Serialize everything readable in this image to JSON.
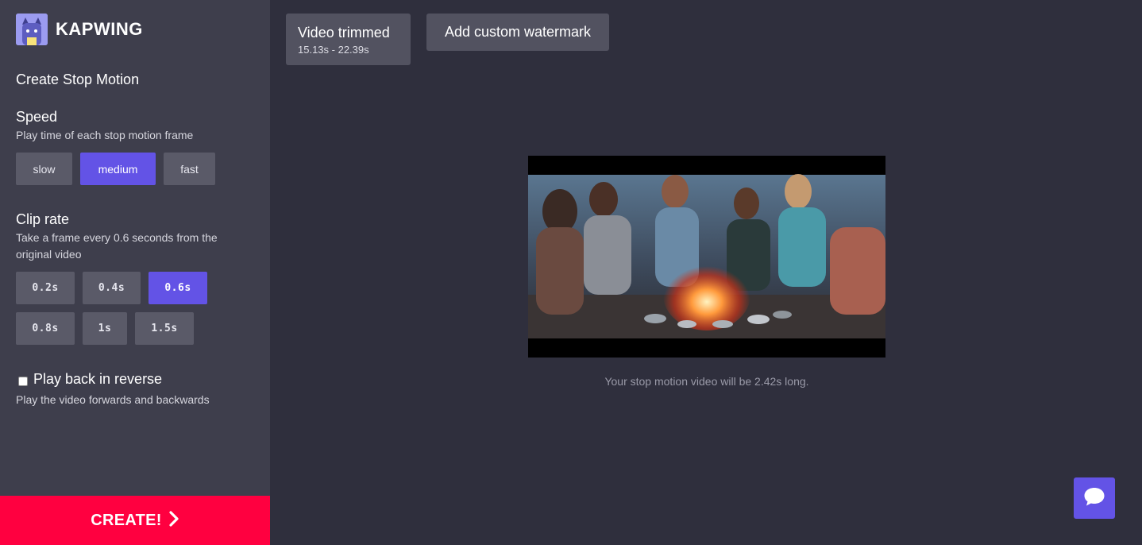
{
  "app": {
    "name": "KAPWING",
    "brand_color": "#6353e6",
    "cta_color": "#ff0040"
  },
  "sidebar": {
    "title": "Create Stop Motion",
    "speed": {
      "label": "Speed",
      "description": "Play time of each stop motion frame",
      "options": [
        "slow",
        "medium",
        "fast"
      ],
      "selected": "medium"
    },
    "clip_rate": {
      "label": "Clip rate",
      "description": "Take a frame every 0.6 seconds from the original video",
      "options": [
        "0.2s",
        "0.4s",
        "0.6s",
        "0.8s",
        "1s",
        "1.5s"
      ],
      "selected": "0.6s"
    },
    "reverse": {
      "label": "Play back in reverse",
      "description": "Play the video forwards and backwards",
      "checked": false
    },
    "create_label": "CREATE!"
  },
  "toolbar": {
    "trim_title": "Video trimmed",
    "trim_range": "15.13s - 22.39s",
    "watermark_label": "Add custom watermark"
  },
  "preview": {
    "caption": "Your stop motion video will be 2.42s long."
  },
  "icons": [
    "kapwing-logo-icon",
    "chevron-right-icon",
    "chat-bubble-icon"
  ]
}
